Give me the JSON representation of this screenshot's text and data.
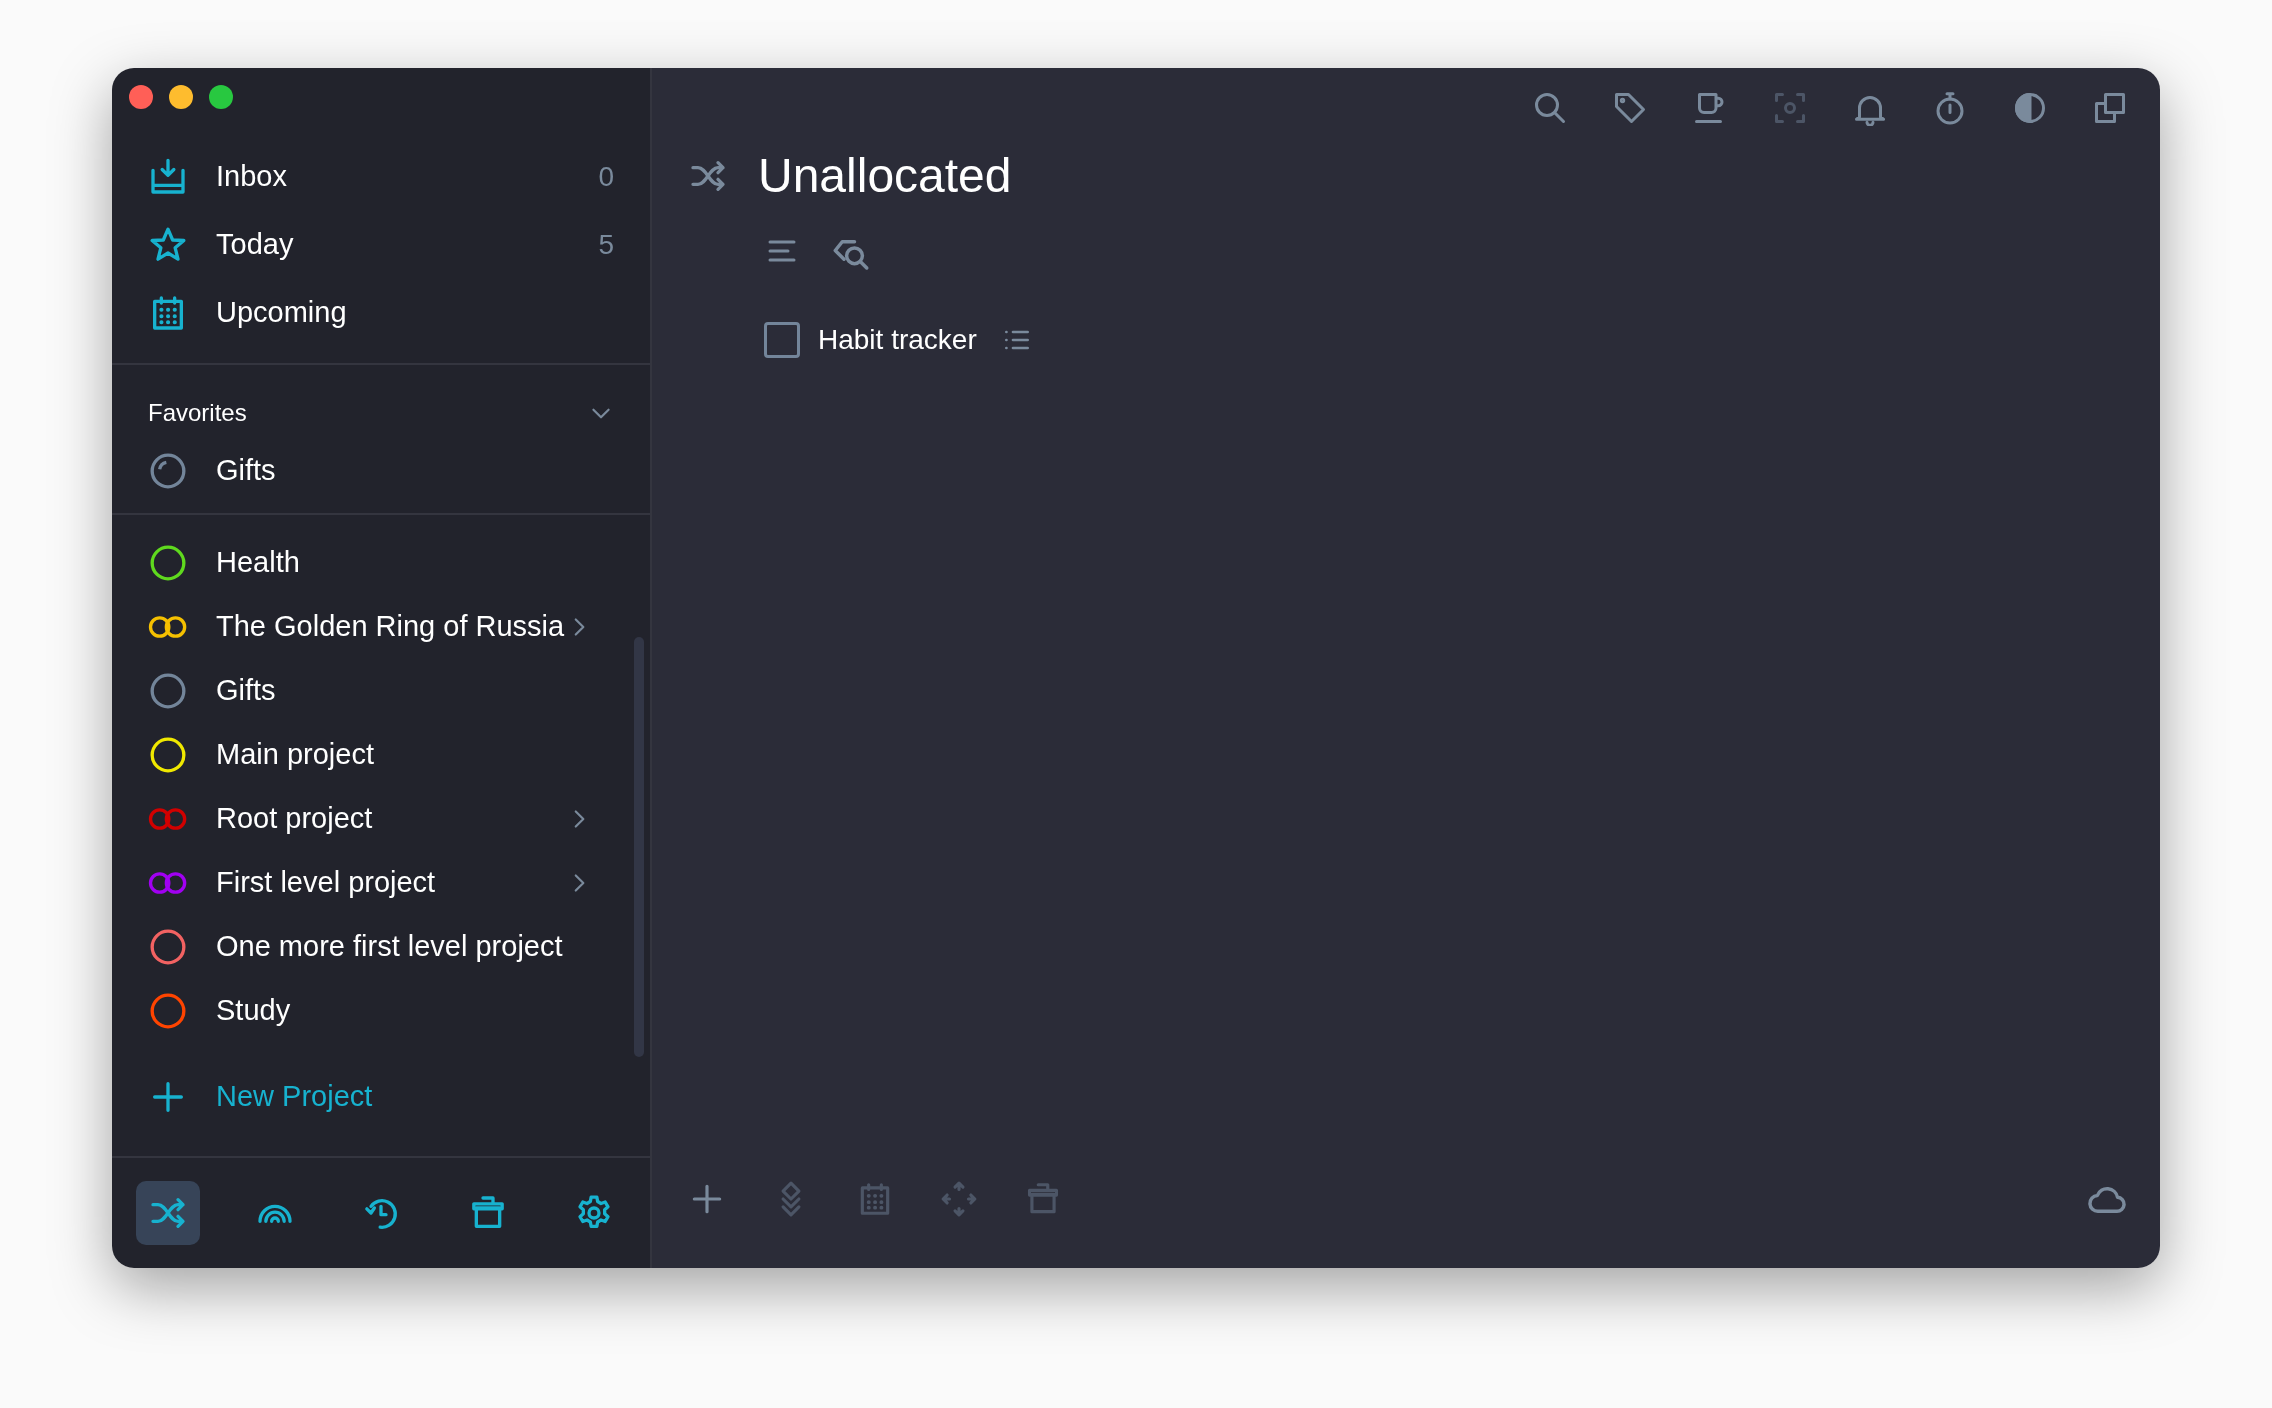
{
  "sidebar": {
    "nav": [
      {
        "label": "Inbox",
        "count": "0"
      },
      {
        "label": "Today",
        "count": "5"
      },
      {
        "label": "Upcoming"
      }
    ],
    "favorites": {
      "title": "Favorites",
      "expanded": true,
      "items": [
        {
          "label": "Gifts",
          "kind": "progress",
          "color": "#73859a"
        }
      ]
    },
    "projects": [
      {
        "label": "Health",
        "kind": "single",
        "color": "#5fd91e",
        "expandable": false
      },
      {
        "label": "The Golden Ring of Russia",
        "kind": "double",
        "color": "#f5c000",
        "expandable": true
      },
      {
        "label": "Gifts",
        "kind": "single",
        "color": "#73859a",
        "expandable": false
      },
      {
        "label": "Main project",
        "kind": "single",
        "color": "#f0e800",
        "expandable": false
      },
      {
        "label": "Root project",
        "kind": "double",
        "color": "#d20000",
        "expandable": true
      },
      {
        "label": "First level project",
        "kind": "double",
        "color": "#a100f2",
        "expandable": true
      },
      {
        "label": "One more first level project",
        "kind": "single",
        "color": "#f26262",
        "expandable": false
      },
      {
        "label": "Study",
        "kind": "single",
        "color": "#ff4400",
        "expandable": false
      }
    ],
    "new_project": "New Project",
    "toolbar": [
      {
        "selected": true
      },
      {
        "selected": false
      },
      {
        "selected": false
      },
      {
        "selected": false
      },
      {
        "selected": false
      }
    ]
  },
  "main": {
    "title": "Unallocated",
    "top_toolbar": [
      {
        "disabled": false
      },
      {
        "disabled": false
      },
      {
        "disabled": false
      },
      {
        "disabled": true
      },
      {
        "disabled": false
      },
      {
        "disabled": false
      },
      {
        "disabled": false
      },
      {
        "disabled": false
      }
    ],
    "tasks": [
      {
        "label": "Habit tracker",
        "checked": false
      }
    ],
    "bottom_toolbar": [
      {
        "disabled": false
      },
      {
        "disabled": true
      },
      {
        "disabled": true
      },
      {
        "disabled": true
      },
      {
        "disabled": true
      }
    ]
  }
}
